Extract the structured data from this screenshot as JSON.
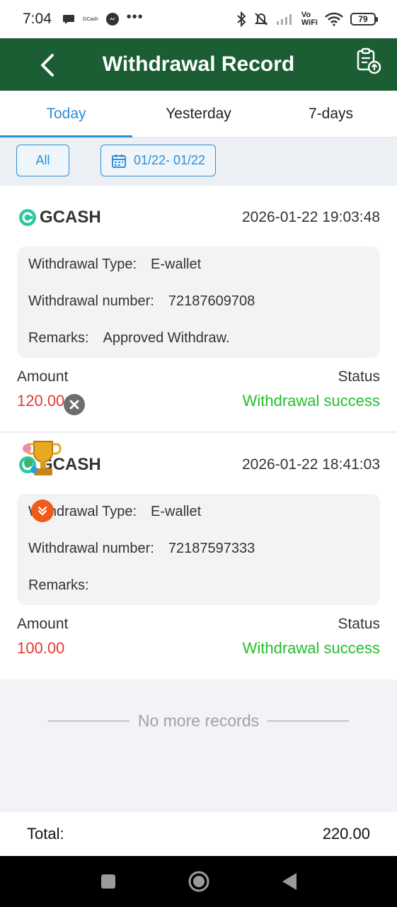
{
  "status_bar": {
    "time": "7:04",
    "gcash_text": "GCash",
    "more_dots": "•••",
    "vowifi_top": "Vo",
    "vowifi_bottom": "WiFi",
    "battery": "79"
  },
  "header": {
    "title": "Withdrawal Record"
  },
  "tabs": [
    {
      "label": "Today",
      "active": true
    },
    {
      "label": "Yesterday",
      "active": false
    },
    {
      "label": "7-days",
      "active": false
    }
  ],
  "filter": {
    "all_label": "All",
    "date_range": "01/22- 01/22"
  },
  "records": [
    {
      "brand": "GCASH",
      "time": "2026-01-22 19:03:48",
      "type_label": "Withdrawal Type:",
      "type_value": "E-wallet",
      "number_label": "Withdrawal number:",
      "number_value": "72187609708",
      "remarks_label": "Remarks:",
      "remarks_value": "Approved Withdraw.",
      "amount_label": "Amount",
      "amount_value": "120.00",
      "status_label": "Status",
      "status_value": "Withdrawal success"
    },
    {
      "brand": "GCASH",
      "time": "2026-01-22 18:41:03",
      "type_label": "Withdrawal Type:",
      "type_value": "E-wallet",
      "number_label": "Withdrawal number:",
      "number_value": "72187597333",
      "remarks_label": "Remarks:",
      "remarks_value": "",
      "amount_label": "Amount",
      "amount_value": "100.00",
      "status_label": "Status",
      "status_value": "Withdrawal success"
    }
  ],
  "footer": {
    "no_more": "No more records",
    "total_label": "Total:",
    "total_value": "220.00"
  },
  "colors": {
    "header_green": "#1b5e33",
    "accent_blue": "#2f8fd6",
    "amount_red": "#e23b2e",
    "success_green": "#22c02a"
  },
  "icons": [
    "back-arrow-icon",
    "record-upload-icon",
    "calendar-icon",
    "gcash-logo-icon",
    "close-icon",
    "trophy-icon",
    "chevron-down-icon",
    "bluetooth-icon",
    "mute-icon",
    "wifi-icon",
    "messenger-icon"
  ]
}
